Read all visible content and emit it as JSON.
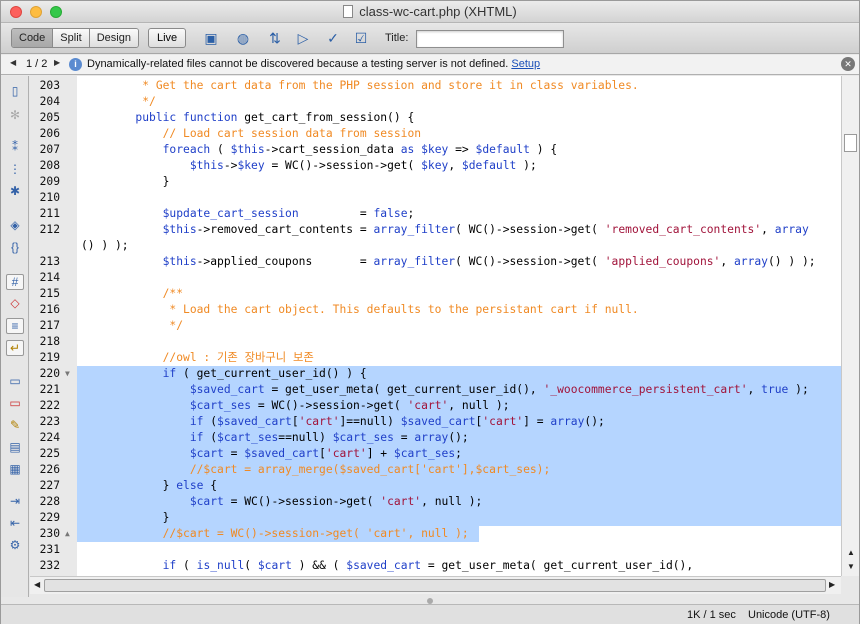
{
  "window": {
    "title": "class-wc-cart.php (XHTML)"
  },
  "toolbar": {
    "views": [
      "Code",
      "Split",
      "Design"
    ],
    "live_label": "Live",
    "title_label": "Title:",
    "title_value": "",
    "icons": [
      "file-management-icon",
      "globe-preview-icon",
      "refresh-design-view-icon",
      "visual-aids-icon",
      "validate-markup-icon",
      "check-browser-compat-icon"
    ]
  },
  "infobar": {
    "page": "1 / 2",
    "message": "Dynamically-related files cannot be discovered because a testing server is not defined.",
    "link": "Setup"
  },
  "sidebar": {
    "icons": [
      "open-documents-icon",
      "show-code-navigator-icon",
      "collapse-full-tag-icon",
      "collapse-selection-icon",
      "expand-all-icon",
      "select-parent-tag-icon",
      "balance-braces-icon",
      "line-numbers-icon",
      "highlight-invalid-code-icon",
      "syntax-coloring-icon",
      "word-wrap-icon",
      "apply-comment-icon",
      "remove-comment-icon",
      "wrap-tag-icon",
      "recent-snippets-icon",
      "move-css-icon",
      "indent-code-icon",
      "outdent-code-icon",
      "format-source-icon"
    ]
  },
  "editor": {
    "lines": [
      {
        "n": "203",
        "fold": "",
        "sel": false,
        "segs": [
          {
            "t": "         * Get the cart data from the PHP session and store it in class variables.",
            "c": "com"
          }
        ]
      },
      {
        "n": "204",
        "fold": "",
        "sel": false,
        "segs": [
          {
            "t": "         */",
            "c": "com"
          }
        ]
      },
      {
        "n": "205",
        "fold": "",
        "sel": false,
        "segs": [
          {
            "t": "        public function ",
            "c": "kw"
          },
          {
            "t": "get_cart_from_session() {",
            "c": "fn"
          }
        ]
      },
      {
        "n": "206",
        "fold": "",
        "sel": false,
        "segs": [
          {
            "t": "            // Load cart session data from session",
            "c": "com"
          }
        ]
      },
      {
        "n": "207",
        "fold": "",
        "sel": false,
        "segs": [
          {
            "t": "            foreach ",
            "c": "kw"
          },
          {
            "t": "( ",
            "c": "fn"
          },
          {
            "t": "$this",
            "c": "var"
          },
          {
            "t": "->cart_session_data ",
            "c": "fn"
          },
          {
            "t": "as ",
            "c": "kw"
          },
          {
            "t": "$key ",
            "c": "var"
          },
          {
            "t": "=> ",
            "c": "fn"
          },
          {
            "t": "$default ",
            "c": "var"
          },
          {
            "t": ") {",
            "c": "fn"
          }
        ]
      },
      {
        "n": "208",
        "fold": "",
        "sel": false,
        "segs": [
          {
            "t": "                $this",
            "c": "var"
          },
          {
            "t": "->",
            "c": "fn"
          },
          {
            "t": "$key ",
            "c": "var"
          },
          {
            "t": "= WC()->session->get( ",
            "c": "fn"
          },
          {
            "t": "$key",
            "c": "var"
          },
          {
            "t": ", ",
            "c": "fn"
          },
          {
            "t": "$default ",
            "c": "var"
          },
          {
            "t": ");",
            "c": "fn"
          }
        ]
      },
      {
        "n": "209",
        "fold": "",
        "sel": false,
        "segs": [
          {
            "t": "            }",
            "c": "fn"
          }
        ]
      },
      {
        "n": "210",
        "fold": "",
        "sel": false,
        "segs": [
          {
            "t": "",
            "c": "fn"
          }
        ]
      },
      {
        "n": "211",
        "fold": "",
        "sel": false,
        "segs": [
          {
            "t": "            $update_cart_session",
            "c": "var"
          },
          {
            "t": "         = ",
            "c": "fn"
          },
          {
            "t": "false",
            "c": "kw"
          },
          {
            "t": ";",
            "c": "fn"
          }
        ]
      },
      {
        "n": "212",
        "fold": "",
        "sel": false,
        "segs": [
          {
            "t": "            $this",
            "c": "var"
          },
          {
            "t": "->removed_cart_contents ",
            "c": "fn"
          },
          {
            "t": "= ",
            "c": "fn"
          },
          {
            "t": "array_filter",
            "c": "kw"
          },
          {
            "t": "( WC()->session->get( ",
            "c": "fn"
          },
          {
            "t": "'removed_cart_contents'",
            "c": "str"
          },
          {
            "t": ", ",
            "c": "fn"
          },
          {
            "t": "array",
            "c": "kw"
          }
        ]
      },
      {
        "n": "",
        "fold": "",
        "sel": false,
        "segs": [
          {
            "t": "() ) );",
            "c": "fn"
          }
        ],
        "wrap": true
      },
      {
        "n": "213",
        "fold": "",
        "sel": false,
        "segs": [
          {
            "t": "            $this",
            "c": "var"
          },
          {
            "t": "->applied_coupons       = ",
            "c": "fn"
          },
          {
            "t": "array_filter",
            "c": "kw"
          },
          {
            "t": "( WC()->session->get( ",
            "c": "fn"
          },
          {
            "t": "'applied_coupons'",
            "c": "str"
          },
          {
            "t": ", ",
            "c": "fn"
          },
          {
            "t": "array",
            "c": "kw"
          },
          {
            "t": "() ) );",
            "c": "fn"
          }
        ]
      },
      {
        "n": "214",
        "fold": "",
        "sel": false,
        "segs": [
          {
            "t": "",
            "c": "fn"
          }
        ]
      },
      {
        "n": "215",
        "fold": "",
        "sel": false,
        "segs": [
          {
            "t": "            /**",
            "c": "com"
          }
        ]
      },
      {
        "n": "216",
        "fold": "",
        "sel": false,
        "segs": [
          {
            "t": "             * Load the cart object. This defaults to the persistant cart if null.",
            "c": "com"
          }
        ]
      },
      {
        "n": "217",
        "fold": "",
        "sel": false,
        "segs": [
          {
            "t": "             */",
            "c": "com"
          }
        ]
      },
      {
        "n": "218",
        "fold": "",
        "sel": false,
        "segs": [
          {
            "t": "",
            "c": "fn"
          }
        ]
      },
      {
        "n": "219",
        "fold": "",
        "sel": false,
        "segs": [
          {
            "t": "            //owl : 기존 장바구니 보존",
            "c": "com"
          }
        ]
      },
      {
        "n": "220",
        "fold": "▼",
        "sel": true,
        "segs": [
          {
            "t": "            if ",
            "c": "kw"
          },
          {
            "t": "( get_current_user_id() ) {",
            "c": "fn"
          }
        ]
      },
      {
        "n": "221",
        "fold": "",
        "sel": true,
        "segs": [
          {
            "t": "                $saved_cart ",
            "c": "var"
          },
          {
            "t": "= get_user_meta( get_current_user_id(), ",
            "c": "fn"
          },
          {
            "t": "'_woocommerce_persistent_cart'",
            "c": "str"
          },
          {
            "t": ", ",
            "c": "fn"
          },
          {
            "t": "true ",
            "c": "kw"
          },
          {
            "t": ");",
            "c": "fn"
          }
        ]
      },
      {
        "n": "222",
        "fold": "",
        "sel": true,
        "segs": [
          {
            "t": "                $cart_ses ",
            "c": "var"
          },
          {
            "t": "= WC()->session->get( ",
            "c": "fn"
          },
          {
            "t": "'cart'",
            "c": "str"
          },
          {
            "t": ", null );",
            "c": "fn"
          }
        ]
      },
      {
        "n": "223",
        "fold": "",
        "sel": true,
        "segs": [
          {
            "t": "                if ",
            "c": "kw"
          },
          {
            "t": "(",
            "c": "fn"
          },
          {
            "t": "$saved_cart",
            "c": "var"
          },
          {
            "t": "[",
            "c": "fn"
          },
          {
            "t": "'cart'",
            "c": "str"
          },
          {
            "t": "]==null) ",
            "c": "fn"
          },
          {
            "t": "$saved_cart",
            "c": "var"
          },
          {
            "t": "[",
            "c": "fn"
          },
          {
            "t": "'cart'",
            "c": "str"
          },
          {
            "t": "] = ",
            "c": "fn"
          },
          {
            "t": "array",
            "c": "kw"
          },
          {
            "t": "();",
            "c": "fn"
          }
        ]
      },
      {
        "n": "224",
        "fold": "",
        "sel": true,
        "segs": [
          {
            "t": "                if ",
            "c": "kw"
          },
          {
            "t": "(",
            "c": "fn"
          },
          {
            "t": "$cart_ses",
            "c": "var"
          },
          {
            "t": "==null) ",
            "c": "fn"
          },
          {
            "t": "$cart_ses ",
            "c": "var"
          },
          {
            "t": "= ",
            "c": "fn"
          },
          {
            "t": "array",
            "c": "kw"
          },
          {
            "t": "();",
            "c": "fn"
          }
        ]
      },
      {
        "n": "225",
        "fold": "",
        "sel": true,
        "segs": [
          {
            "t": "                $cart ",
            "c": "var"
          },
          {
            "t": "= ",
            "c": "fn"
          },
          {
            "t": "$saved_cart",
            "c": "var"
          },
          {
            "t": "[",
            "c": "fn"
          },
          {
            "t": "'cart'",
            "c": "str"
          },
          {
            "t": "] + ",
            "c": "fn"
          },
          {
            "t": "$cart_ses",
            "c": "var"
          },
          {
            "t": ";",
            "c": "fn"
          }
        ]
      },
      {
        "n": "226",
        "fold": "",
        "sel": true,
        "segs": [
          {
            "t": "                //$cart = array_merge($saved_cart['cart'],$cart_ses);",
            "c": "com"
          }
        ]
      },
      {
        "n": "227",
        "fold": "",
        "sel": true,
        "segs": [
          {
            "t": "            } ",
            "c": "fn"
          },
          {
            "t": "else ",
            "c": "kw"
          },
          {
            "t": "{",
            "c": "fn"
          }
        ]
      },
      {
        "n": "228",
        "fold": "",
        "sel": true,
        "segs": [
          {
            "t": "                $cart ",
            "c": "var"
          },
          {
            "t": "= WC()->session->get( ",
            "c": "fn"
          },
          {
            "t": "'cart'",
            "c": "str"
          },
          {
            "t": ", null );",
            "c": "fn"
          }
        ]
      },
      {
        "n": "229",
        "fold": "",
        "sel": true,
        "segs": [
          {
            "t": "            }",
            "c": "fn"
          }
        ]
      },
      {
        "n": "230",
        "fold": "▲",
        "sel": true,
        "partial": true,
        "segs": [
          {
            "t": "            //$cart = WC()->session->get( 'cart', null );",
            "c": "com"
          }
        ]
      },
      {
        "n": "231",
        "fold": "",
        "sel": false,
        "segs": [
          {
            "t": "",
            "c": "fn"
          }
        ]
      },
      {
        "n": "232",
        "fold": "",
        "sel": false,
        "segs": [
          {
            "t": "            if ",
            "c": "kw"
          },
          {
            "t": "( ",
            "c": "fn"
          },
          {
            "t": "is_null",
            "c": "kw"
          },
          {
            "t": "( ",
            "c": "fn"
          },
          {
            "t": "$cart ",
            "c": "var"
          },
          {
            "t": ") && ( ",
            "c": "fn"
          },
          {
            "t": "$saved_cart ",
            "c": "var"
          },
          {
            "t": "= get_user_meta( get_current_user_id(),",
            "c": "fn"
          }
        ]
      }
    ]
  },
  "status": {
    "size": "1K / 1 sec",
    "encoding": "Unicode (UTF-8)"
  }
}
